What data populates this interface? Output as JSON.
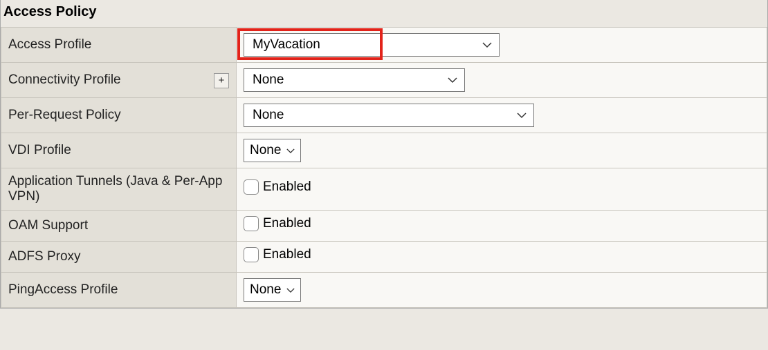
{
  "section": {
    "title": "Access Policy"
  },
  "rows": {
    "access_profile": {
      "label": "Access Profile",
      "value": "MyVacation"
    },
    "connectivity_profile": {
      "label": "Connectivity Profile",
      "value": "None",
      "plus": "+"
    },
    "per_request_policy": {
      "label": "Per-Request Policy",
      "value": "None"
    },
    "vdi_profile": {
      "label": "VDI Profile",
      "value": "None"
    },
    "app_tunnels": {
      "label": "Application Tunnels (Java & Per-App VPN)",
      "option": "Enabled"
    },
    "oam_support": {
      "label": "OAM Support",
      "option": "Enabled"
    },
    "adfs_proxy": {
      "label": "ADFS Proxy",
      "option": "Enabled"
    },
    "pingaccess_profile": {
      "label": "PingAccess Profile",
      "value": "None"
    }
  }
}
